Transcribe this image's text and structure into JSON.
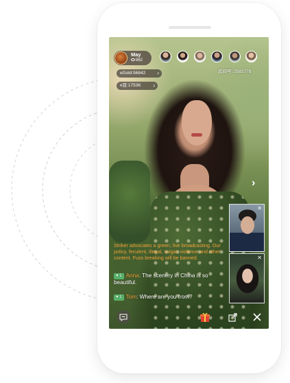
{
  "host": {
    "name": "May",
    "views": "862"
  },
  "room": {
    "id_text": "房间号: 2582778"
  },
  "wallet": {
    "gold_label": "eGold:56842",
    "bean_label": "e豆:17536"
  },
  "chat": {
    "system_notice": "Striker advocates a green, live broadcasting. Our policy, feculent, illegal, vulgar, violence and other content. Fuss breaking will be banned.",
    "messages": [
      {
        "level": "1",
        "user": "Anna",
        "text": "The scenery in China is so beautiful."
      },
      {
        "level": "1",
        "user": "Tom",
        "text": "Where are you from?"
      }
    ]
  },
  "colors": {
    "accent": "#f2a23a",
    "level_badge": "#57b36a",
    "pill_bg": "#3c3732"
  },
  "icons": [
    "eye-icon",
    "chevron-right-icon",
    "close-icon",
    "chat-bubble-icon",
    "gift-icon",
    "share-icon"
  ]
}
